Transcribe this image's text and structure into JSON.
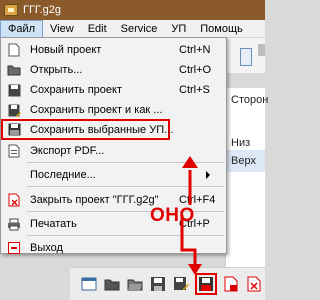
{
  "window": {
    "title": "ГГГ.g2g"
  },
  "menubar": {
    "items": [
      "Файл",
      "View",
      "Edit",
      "Service",
      "УП",
      "Помощь"
    ]
  },
  "file_menu": {
    "items": [
      {
        "label": "Новый проект",
        "shortcut": "Ctrl+N",
        "icon": "new-file-icon"
      },
      {
        "label": "Открыть...",
        "shortcut": "Ctrl+O",
        "icon": "folder-open-icon"
      },
      {
        "label": "Сохранить проект",
        "shortcut": "Ctrl+S",
        "icon": "save-icon"
      },
      {
        "label": "Сохранить проект и как ...",
        "shortcut": "",
        "icon": "save-as-icon"
      },
      {
        "label": "Сохранить выбранные УП...",
        "shortcut": "",
        "icon": "save-selected-icon"
      },
      {
        "label": "Экспорт PDF...",
        "shortcut": "",
        "icon": "pdf-icon"
      },
      {
        "label": "Последние...",
        "shortcut": "",
        "icon": ""
      },
      {
        "label": "Закрыть проект \"ГГГ.g2g\"",
        "shortcut": "Ctrl+F4",
        "icon": "close-project-icon"
      },
      {
        "label": "Печатать",
        "shortcut": "Ctrl+P",
        "icon": "printer-icon"
      },
      {
        "label": "Выход",
        "shortcut": "",
        "icon": "exit-icon"
      }
    ]
  },
  "background": {
    "header": "Сторон",
    "cells": [
      "Низ",
      "Верх"
    ]
  },
  "annotation": {
    "text": "ОНО",
    "color": "#e00000"
  },
  "colors": {
    "titlebar": "#8a5a2b",
    "highlight": "#e00000"
  }
}
